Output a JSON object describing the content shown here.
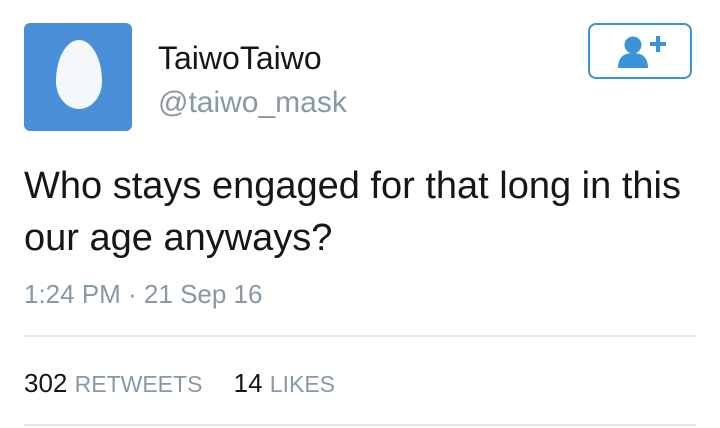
{
  "user": {
    "display_name": "TaiwoTaiwo",
    "handle": "@taiwo_mask",
    "avatar_icon": "default-egg-avatar"
  },
  "follow_button": {
    "icon": "follow-user-plus-icon",
    "accent_color": "#3b94d9"
  },
  "tweet": {
    "text": "Who stays engaged for that long in this our age anyways?",
    "timestamp": "1:24 PM · 21 Sep 16"
  },
  "stats": {
    "retweets_count": "302",
    "retweets_label": "RETWEETS",
    "likes_count": "14",
    "likes_label": "LIKES"
  }
}
